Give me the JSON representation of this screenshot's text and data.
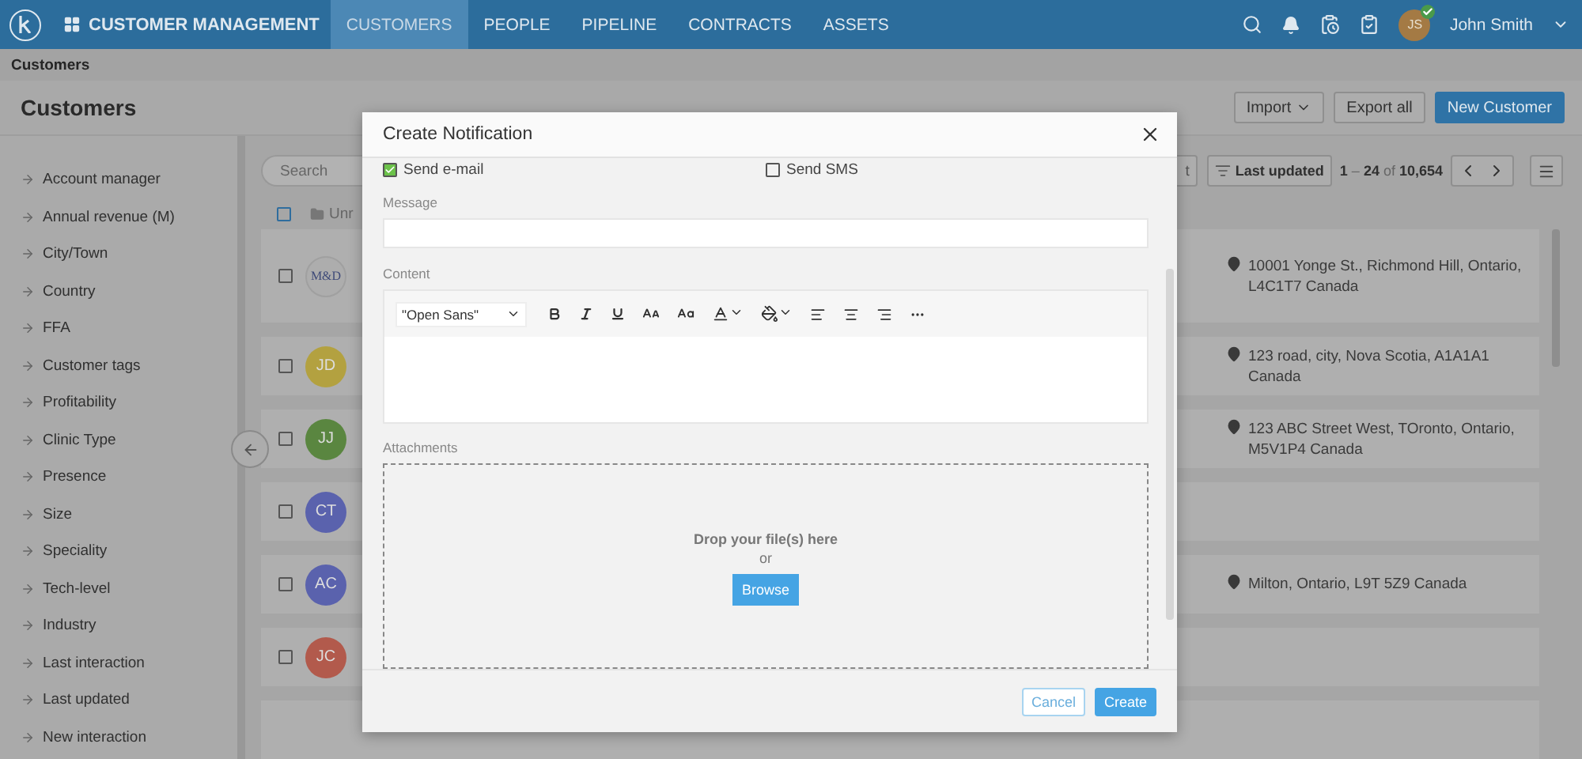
{
  "app": {
    "title": "CUSTOMER MANAGEMENT"
  },
  "nav": [
    {
      "label": "CUSTOMERS",
      "selected": true
    },
    {
      "label": "PEOPLE",
      "selected": false
    },
    {
      "label": "PIPELINE",
      "selected": false
    },
    {
      "label": "CONTRACTS",
      "selected": false
    },
    {
      "label": "ASSETS",
      "selected": false
    }
  ],
  "user": {
    "initials": "JS",
    "name": "John Smith",
    "verified": true
  },
  "breadcrumb": "Customers",
  "page_title": "Customers",
  "page_actions": [
    {
      "label": "Import",
      "kind": "dropdown"
    },
    {
      "label": "Export all",
      "kind": "plain"
    },
    {
      "label": "New Customer",
      "kind": "primary"
    }
  ],
  "filters": [
    "Account manager",
    "Annual revenue (M)",
    "City/Town",
    "Country",
    "FFA",
    "Customer tags",
    "Profitability",
    "Clinic Type",
    "Presence",
    "Size",
    "Speciality",
    "Tech-level",
    "Industry",
    "Last interaction",
    "Last updated",
    "New interaction"
  ],
  "search": {
    "placeholder": "Search"
  },
  "toolbar": {
    "cut_button": "t",
    "sort": "Last updated",
    "pagination": "**1** – **24** of **10,654**"
  },
  "list_header": {
    "checked": false,
    "folder": "Unr"
  },
  "rows": [
    {
      "kind": "logo",
      "avatar": "M&D",
      "color": "#adadad",
      "checked": false,
      "address": "10001 Yonge St., Richmond Hill, Ontario, L4C1T7 Canada"
    },
    {
      "kind": "initials",
      "avatar": "JD",
      "color": "#b3a140",
      "checked": false,
      "address": "123 road, city, Nova Scotia, A1A1A1 Canada"
    },
    {
      "kind": "initials",
      "avatar": "JJ",
      "color": "#5a8640",
      "checked": false,
      "address": "123 ABC Street West, TOronto, Ontario, M5V1P4 Canada"
    },
    {
      "kind": "initials",
      "avatar": "CT",
      "color": "#5a62ad",
      "checked": false
    },
    {
      "kind": "initials",
      "avatar": "AC",
      "color": "#5a62ad",
      "checked": false,
      "address": "Milton, Ontario, L9T 5Z9 Canada"
    },
    {
      "kind": "initials",
      "avatar": "JC",
      "color": "#b25a4c",
      "checked": false
    }
  ],
  "dialog": {
    "title": "Create Notification",
    "options": [
      {
        "label": "Send e-mail",
        "checked": true
      },
      {
        "label": "Send SMS",
        "checked": false
      }
    ],
    "message_label": "Message",
    "content_label": "Content",
    "font": "\"Open Sans\"",
    "attachments_label": "Attachments",
    "drop_text": "Drop your file(s) here",
    "or_text": "or",
    "browse": "Browse",
    "buttons": [
      {
        "label": "Cancel",
        "kind": "secondary"
      },
      {
        "label": "Create",
        "kind": "primary"
      }
    ]
  }
}
